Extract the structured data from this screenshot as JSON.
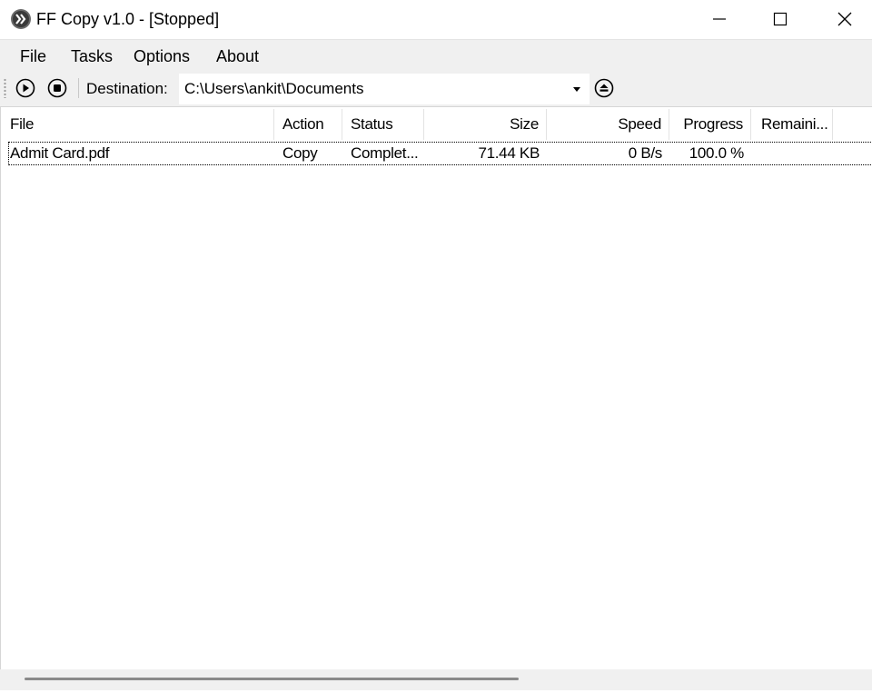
{
  "window": {
    "title": "FF Copy v1.0 - [Stopped]",
    "icons": {
      "app": "ff-copy-logo-icon",
      "minimize": "minimize-icon",
      "maximize": "maximize-icon",
      "close": "close-icon"
    }
  },
  "menu": {
    "items": [
      {
        "label": "File"
      },
      {
        "label": "Tasks"
      },
      {
        "label": "Options"
      },
      {
        "label": "About"
      }
    ]
  },
  "toolbar": {
    "icons": {
      "start": "play-icon",
      "stop": "stop-icon",
      "eject": "eject-icon"
    },
    "destination_label": "Destination:",
    "destination_value": "C:\\Users\\ankit\\Documents"
  },
  "list": {
    "columns": [
      "File",
      "Action",
      "Status",
      "Size",
      "Speed",
      "Progress",
      "Remaini..."
    ],
    "rows": [
      {
        "file": "Admit Card.pdf",
        "action": "Copy",
        "status": "Complet...",
        "size": "71.44 KB",
        "speed": "0 B/s",
        "progress": "100.0 %",
        "remaining": ""
      }
    ]
  },
  "colors": {
    "chrome_bg": "#f0f0f0",
    "list_bg": "#ffffff",
    "scroll_thumb": "#8a8a8a"
  }
}
